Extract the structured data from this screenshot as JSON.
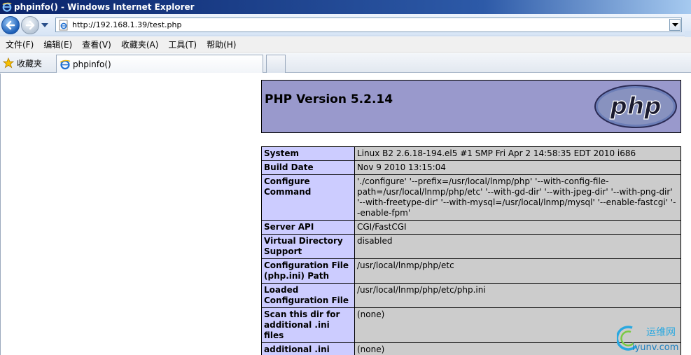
{
  "window": {
    "title": "phpinfo() - Windows Internet Explorer"
  },
  "address_bar": {
    "url": "http://192.168.1.39/test.php"
  },
  "menu": {
    "items": [
      "文件(F)",
      "编辑(E)",
      "查看(V)",
      "收藏夹(A)",
      "工具(T)",
      "帮助(H)"
    ]
  },
  "favorites": {
    "label": "收藏夹"
  },
  "tab": {
    "title": "phpinfo()"
  },
  "php": {
    "version_heading": "PHP Version 5.2.14",
    "logo_text": "php"
  },
  "info_rows": [
    {
      "key": "System",
      "value": "Linux B2 2.6.18-194.el5 #1 SMP Fri Apr 2 14:58:35 EDT 2010 i686"
    },
    {
      "key": "Build Date",
      "value": "Nov 9 2010 13:15:04"
    },
    {
      "key": "Configure Command",
      "value": "'./configure' '--prefix=/usr/local/lnmp/php' '--with-config-file-path=/usr/local/lnmp/php/etc' '--with-gd-dir' '--with-jpeg-dir' '--with-png-dir' '--with-freetype-dir' '--with-mysql=/usr/local/lnmp/mysql' '--enable-fastcgi' '--enable-fpm'"
    },
    {
      "key": "Server API",
      "value": "CGI/FastCGI"
    },
    {
      "key": "Virtual Directory Support",
      "value": "disabled"
    },
    {
      "key": "Configuration File (php.ini) Path",
      "value": "/usr/local/lnmp/php/etc"
    },
    {
      "key": "Loaded Configuration File",
      "value": "/usr/local/lnmp/php/etc/php.ini"
    },
    {
      "key": "Scan this dir for additional .ini files",
      "value": "(none)"
    },
    {
      "key": "additional .ini files parsed",
      "value": "(none)"
    }
  ],
  "watermark": {
    "line1": "运维网",
    "line2": "iyunv.com"
  },
  "colors": {
    "php_header_bg": "#9999cc",
    "key_cell_bg": "#ccccff",
    "value_cell_bg": "#cccccc"
  }
}
